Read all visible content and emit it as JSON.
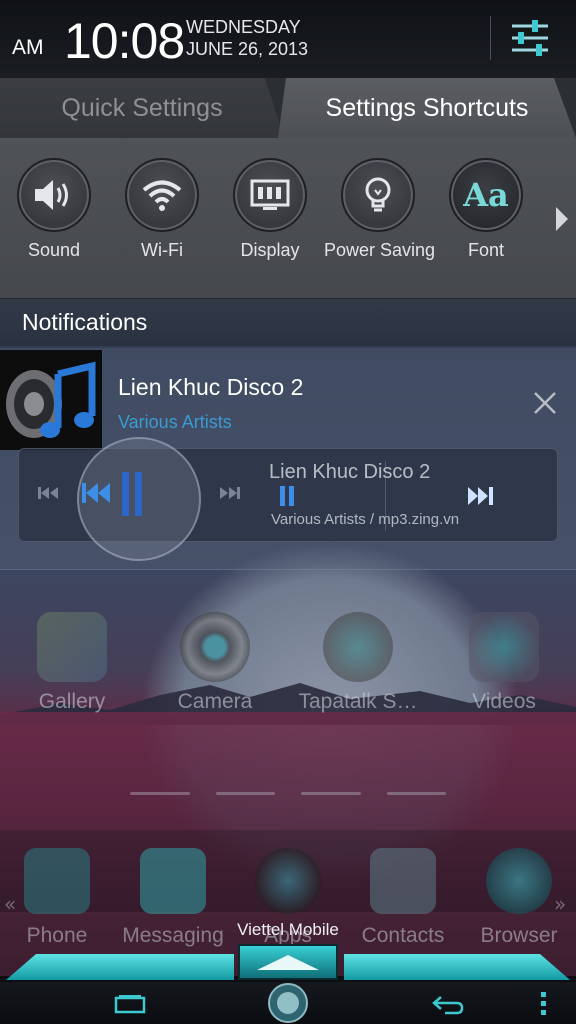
{
  "status": {
    "ampm": "AM",
    "time": "10:08",
    "weekday": "WEDNESDAY",
    "date": "JUNE 26, 2013"
  },
  "tabs": [
    {
      "label": "Quick Settings",
      "active": false
    },
    {
      "label": "Settings Shortcuts",
      "active": true
    }
  ],
  "shortcuts": [
    {
      "label": "Sound",
      "icon": "speaker-icon"
    },
    {
      "label": "Wi-Fi",
      "icon": "wifi-icon"
    },
    {
      "label": "Display",
      "icon": "display-icon"
    },
    {
      "label": "Power Saving",
      "icon": "lightbulb-icon"
    },
    {
      "label": "Font",
      "icon": "font-icon",
      "glyph": "Aa"
    }
  ],
  "notifications": {
    "header": "Notifications",
    "media": {
      "title": "Lien Khuc Disco 2",
      "artist": "Various Artists",
      "player_title": "Lien Khuc Disco 2",
      "player_subtitle": "Various Artists / mp3.zing.vn"
    }
  },
  "home": {
    "apps": [
      "Gallery",
      "Camera",
      "Tapatalk S…",
      "Videos"
    ],
    "dock": [
      "Phone",
      "Messaging",
      "Apps",
      "Contacts",
      "Browser"
    ],
    "carrier": "Viettel Mobile"
  },
  "colors": {
    "accent_cyan": "#3ad0d6",
    "link_blue": "#3a9bd0",
    "panel_gray": "#4f5257"
  }
}
